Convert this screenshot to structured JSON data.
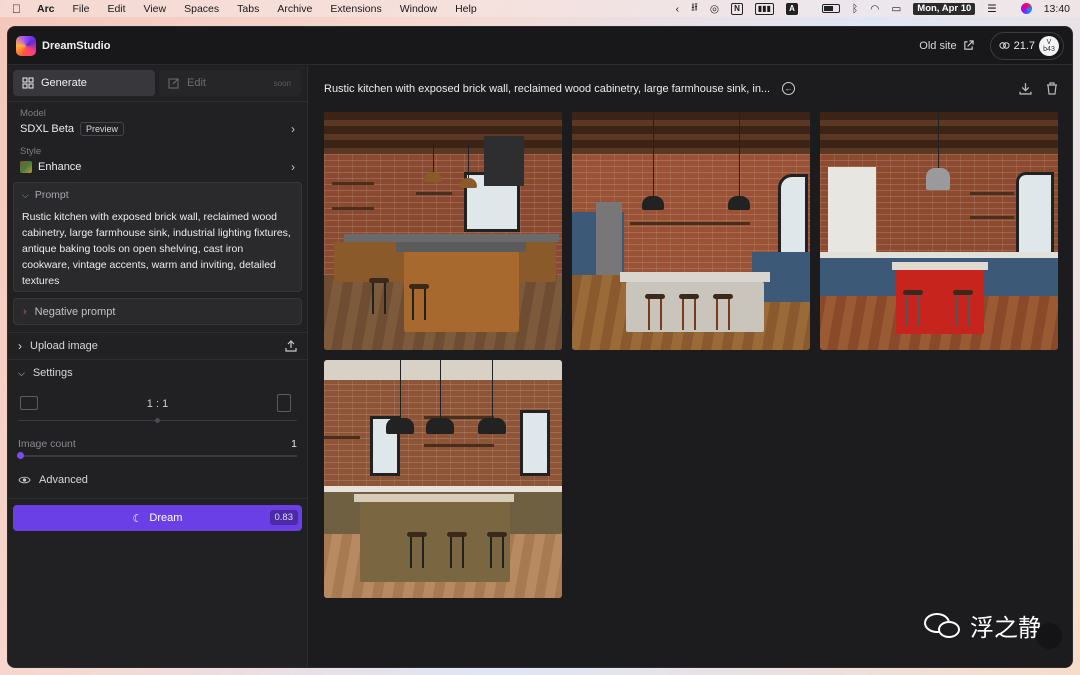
{
  "menubar": {
    "apple": "",
    "items": [
      "Arc",
      "File",
      "Edit",
      "View",
      "Spaces",
      "Tabs",
      "Archive",
      "Extensions",
      "Window",
      "Help"
    ],
    "date": "Mon, Apr 10",
    "time": "13:40",
    "notion_glyph": "N",
    "a_glyph": "A"
  },
  "app": {
    "name": "DreamStudio",
    "old_site": "Old site",
    "credits": "21.7",
    "avatar_text": "V\nb43"
  },
  "sidebar": {
    "tabs": {
      "generate": "Generate",
      "edit": "Edit",
      "edit_badge": "soon"
    },
    "model": {
      "label": "Model",
      "value": "SDXL Beta",
      "badge": "Preview"
    },
    "style": {
      "label": "Style",
      "value": "Enhance"
    },
    "prompt": {
      "label": "Prompt",
      "text": "Rustic kitchen with exposed brick wall, reclaimed wood cabinetry, large farmhouse sink, industrial lighting fixtures, antique baking tools on open shelving, cast iron cookware, vintage accents, warm and inviting, detailed textures"
    },
    "negative_prompt": "Negative prompt",
    "upload_image": "Upload image",
    "settings": "Settings",
    "aspect_ratio": "1 : 1",
    "image_count": {
      "label": "Image count",
      "value": "1",
      "fraction": 0.0
    },
    "advanced": "Advanced",
    "dream": {
      "label": "Dream",
      "cost": "0.83"
    }
  },
  "main": {
    "title": "Rustic kitchen with exposed brick wall, reclaimed wood cabinetry, large farmhouse sink, in...",
    "images": [
      {
        "name": "kitchen-image-1",
        "variant": "wood"
      },
      {
        "name": "kitchen-image-2",
        "variant": "blue"
      },
      {
        "name": "kitchen-image-3",
        "variant": "red"
      },
      {
        "name": "kitchen-image-4",
        "variant": "olive"
      }
    ]
  },
  "watermark": {
    "text": "浮之静"
  },
  "colors": {
    "accent": "#6a3fe6",
    "panel": "#212124",
    "background": "#1c1c1e"
  }
}
